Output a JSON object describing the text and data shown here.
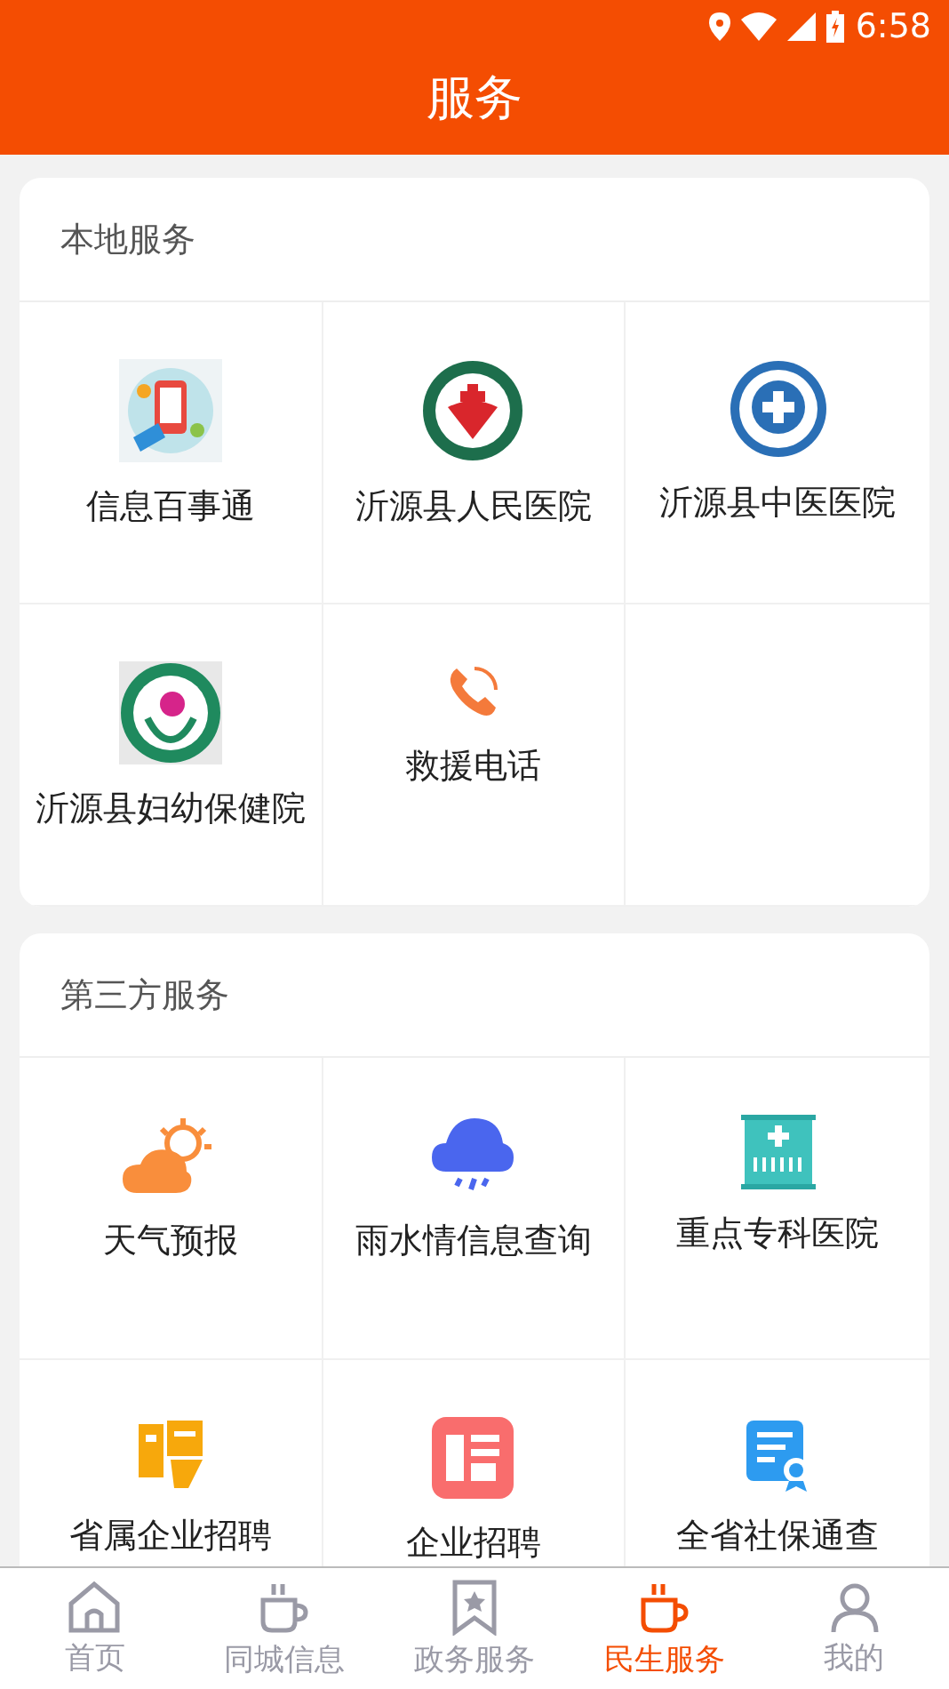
{
  "status_bar": {
    "time": "6:58"
  },
  "header": {
    "title": "服务"
  },
  "sections": [
    {
      "title": "本地服务",
      "items": [
        {
          "label": "信息百事通"
        },
        {
          "label": "沂源县人民医院"
        },
        {
          "label": "沂源县中医医院"
        },
        {
          "label": "沂源县妇幼保健院"
        },
        {
          "label": "救援电话"
        }
      ]
    },
    {
      "title": "第三方服务",
      "items": [
        {
          "label": "天气预报"
        },
        {
          "label": "雨水情信息查询"
        },
        {
          "label": "重点专科医院"
        },
        {
          "label": "省属企业招聘"
        },
        {
          "label": "企业招聘"
        },
        {
          "label": "全省社保通查"
        }
      ]
    }
  ],
  "tab_bar": [
    {
      "label": "首页",
      "selected": false
    },
    {
      "label": "同城信息",
      "selected": false
    },
    {
      "label": "政务服务",
      "selected": false
    },
    {
      "label": "民生服务",
      "selected": true
    },
    {
      "label": "我的",
      "selected": false
    }
  ]
}
